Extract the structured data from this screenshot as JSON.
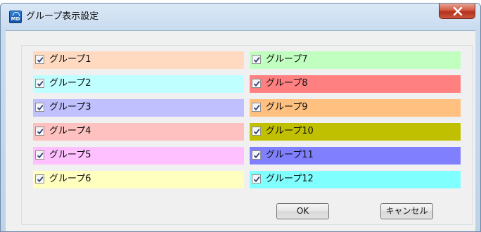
{
  "window": {
    "title": "グループ表示設定",
    "app_icon_text": "MD",
    "close_glyph": "✕"
  },
  "groups": [
    {
      "label": "グループ1",
      "checked": true,
      "color": "#ffdac0"
    },
    {
      "label": "グループ2",
      "checked": true,
      "color": "#c0ffff"
    },
    {
      "label": "グループ3",
      "checked": true,
      "color": "#c0c0ff"
    },
    {
      "label": "グループ4",
      "checked": true,
      "color": "#ffc0c0"
    },
    {
      "label": "グループ5",
      "checked": true,
      "color": "#ffc0ff"
    },
    {
      "label": "グループ6",
      "checked": true,
      "color": "#ffffc0"
    },
    {
      "label": "グループ7",
      "checked": true,
      "color": "#c0ffc0"
    },
    {
      "label": "グループ8",
      "checked": true,
      "color": "#ff8080"
    },
    {
      "label": "グループ9",
      "checked": true,
      "color": "#ffc080"
    },
    {
      "label": "グループ10",
      "checked": true,
      "color": "#c0c000"
    },
    {
      "label": "グループ11",
      "checked": true,
      "color": "#8080ff"
    },
    {
      "label": "グループ12",
      "checked": true,
      "color": "#80ffff"
    }
  ],
  "buttons": {
    "ok_label": "OK",
    "cancel_label": "キャンセル"
  }
}
